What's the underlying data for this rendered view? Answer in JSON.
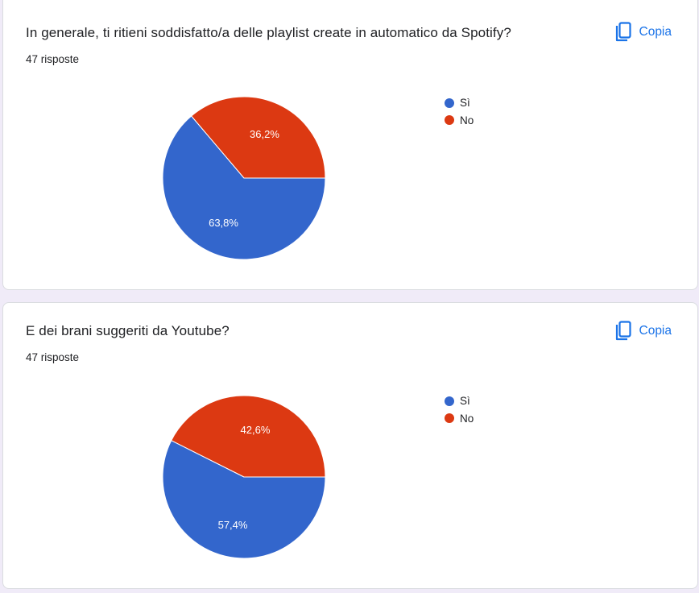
{
  "copy_label": "Copia",
  "chart_data": [
    {
      "type": "pie",
      "title": "In generale, ti ritieni soddisfatto/a delle playlist create in automatico da Spotify?",
      "responses": "47 risposte",
      "categories": [
        "Sì",
        "No"
      ],
      "values": [
        63.8,
        36.2
      ],
      "labels": [
        "63,8%",
        "36,2%"
      ],
      "colors": [
        "#3366cc",
        "#dc3912"
      ],
      "legend": "right"
    },
    {
      "type": "pie",
      "title": "E dei brani suggeriti da Youtube?",
      "responses": "47 risposte",
      "categories": [
        "Sì",
        "No"
      ],
      "values": [
        57.4,
        42.6
      ],
      "labels": [
        "57,4%",
        "42,6%"
      ],
      "colors": [
        "#3366cc",
        "#dc3912"
      ],
      "legend": "right"
    }
  ]
}
